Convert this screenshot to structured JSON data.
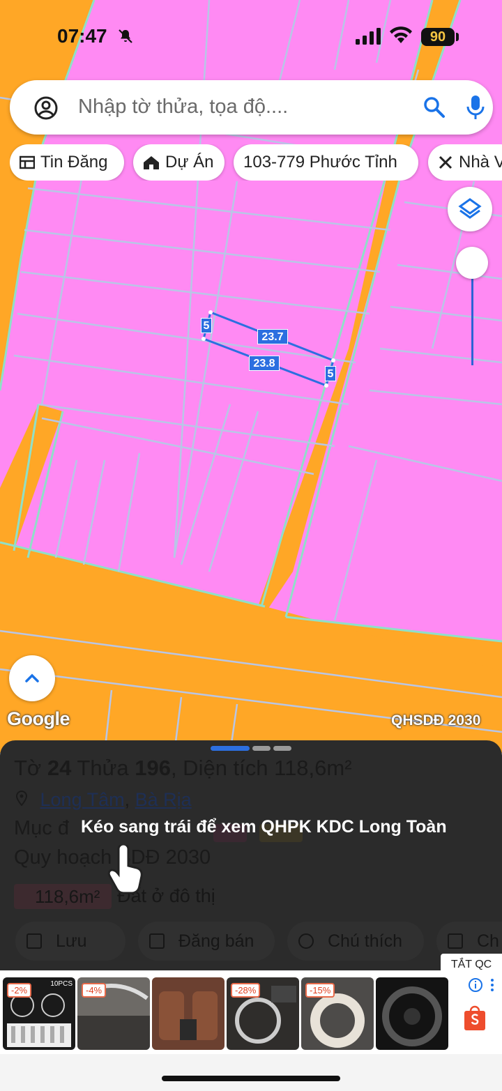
{
  "status": {
    "time": "07:47",
    "battery": "90"
  },
  "search": {
    "placeholder": "Nhập tờ thửa, tọa độ...."
  },
  "chips": [
    "Tin Đăng",
    "Dự Án",
    "103-779 Phước Tỉnh",
    "Nhà V"
  ],
  "map": {
    "edge_labels": {
      "top": "23.7",
      "bottom": "23.8",
      "left": "5",
      "right": "5"
    },
    "google_logo": "Google",
    "layer_name": "QHSDĐ 2030",
    "colors": {
      "residential": "#ff8af3",
      "road": "#ffa726",
      "lot_line": "#8fe0c8",
      "measure": "#2c6fe0"
    }
  },
  "sheet": {
    "title_prefix": "Tờ ",
    "sheet_no": "24",
    "title_mid": " Thửa ",
    "parcel_no": "196",
    "title_suffix": ", Diện tích 118,6m²",
    "ward": "Long Tâm",
    "city": "Bà Rịa",
    "purpose_label": "Mục đ",
    "plan_label": "Quy hoạch",
    "plan_value": "SDĐ 2030",
    "area": "118,6m²",
    "land_type": "Đất ở đô thị",
    "hint": "Kéo sang trái để xem QHPK KDC Long Toàn",
    "actions": [
      "Lưu",
      "Đăng bán",
      "Chú thích",
      "Ch"
    ]
  },
  "ads": {
    "close_label": "TẮT QC",
    "items": [
      {
        "discount": "-2%",
        "tag": "10PCS"
      },
      {
        "discount": "-4%"
      },
      {
        "discount": ""
      },
      {
        "discount": "-28%"
      },
      {
        "discount": "-15%"
      },
      {
        "discount": ""
      }
    ]
  }
}
